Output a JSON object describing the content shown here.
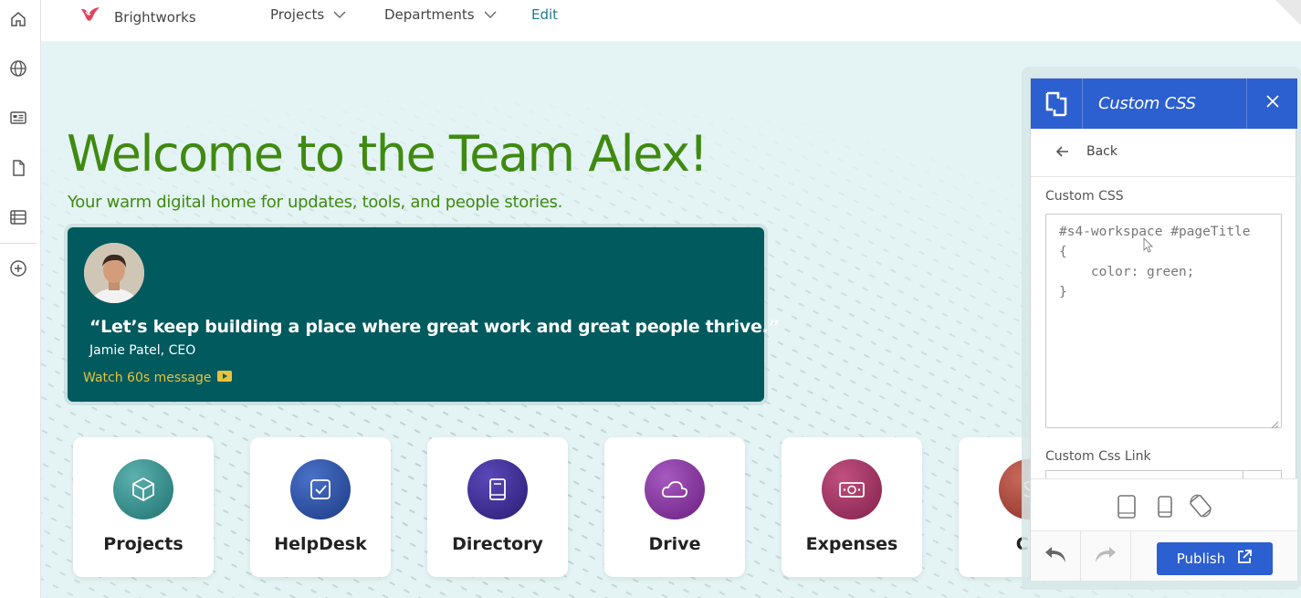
{
  "topnav": {
    "brand": "Brightworks",
    "items": [
      {
        "label": "Projects"
      },
      {
        "label": "Departments"
      }
    ],
    "edit_label": "Edit"
  },
  "hero": {
    "title": "Welcome to the Team Alex!",
    "subtitle": "Your warm digital home for updates, tools, and people stories."
  },
  "quote": {
    "text": "“Let’s keep building a place where great work and great people thrive.”",
    "author": "Jamie Patel, CEO",
    "link": "Watch 60s message"
  },
  "tiles": [
    {
      "label": "Projects",
      "icon": "box-icon",
      "color": "#2a8a88"
    },
    {
      "label": "HelpDesk",
      "icon": "checkbox-icon",
      "color": "#244a9a"
    },
    {
      "label": "Directory",
      "icon": "book-icon",
      "color": "#3a2a8a"
    },
    {
      "label": "Drive",
      "icon": "cloud-icon",
      "color": "#7a2a8a"
    },
    {
      "label": "Expenses",
      "icon": "cash-icon",
      "color": "#9a2a5e"
    },
    {
      "label": "CR",
      "icon": "dollar-icon",
      "color": "#a8403a"
    }
  ],
  "panel": {
    "title": "Custom CSS",
    "back_label": "Back",
    "css_label": "Custom CSS",
    "css_code": "#s4-workspace #pageTitle\n{\n    color: green;\n}",
    "link_label": "Custom Css Link",
    "publish_label": "Publish"
  },
  "colors": {
    "accent": "#2c5fcf",
    "hero_green": "#3f8a10",
    "quote_bg": "#005a5e",
    "link_gold": "#e8c23a"
  }
}
